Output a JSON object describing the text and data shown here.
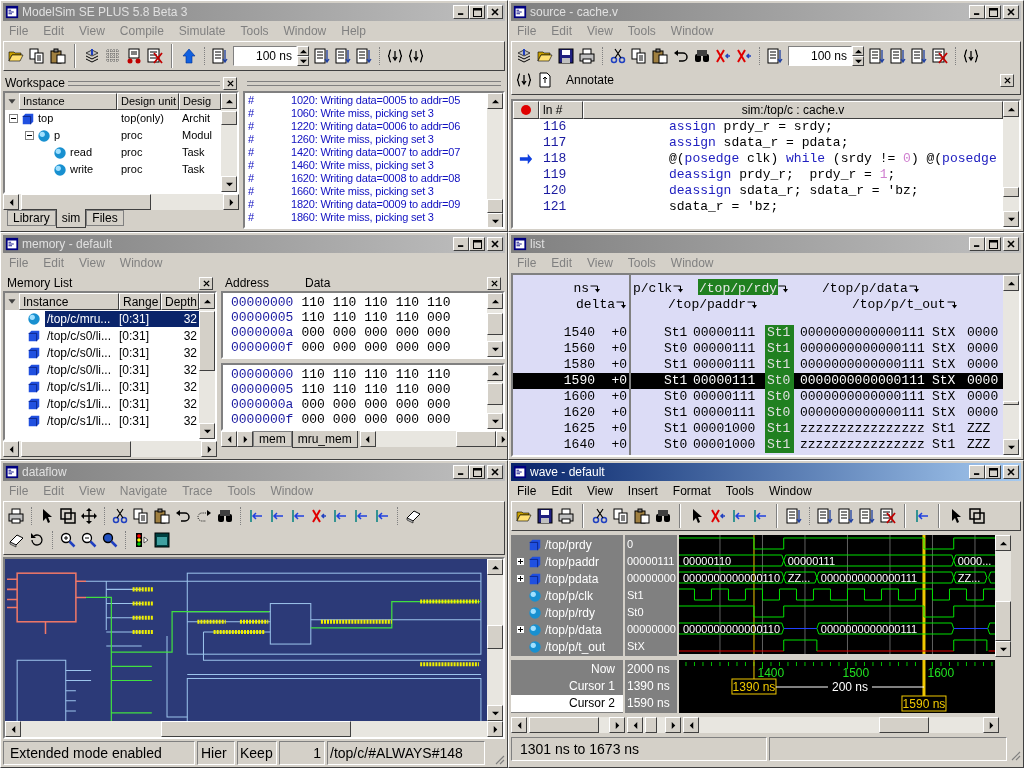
{
  "main_window": {
    "title": "ModelSim SE PLUS 5.8 Beta 3",
    "active": false,
    "menu": [
      "File",
      "Edit",
      "View",
      "Compile",
      "Simulate",
      "Tools",
      "Window",
      "Help"
    ],
    "time_step": "100 ns",
    "workspace": {
      "title": "Workspace",
      "columns": [
        "Instance",
        "Design unit",
        "Desig"
      ],
      "tree": [
        {
          "name": "top",
          "kind": "square",
          "unit": "top(only)",
          "type": "Archit",
          "expanded": true,
          "children": [
            {
              "name": "p",
              "kind": "sphere",
              "unit": "proc",
              "type": "Modul",
              "expanded": true,
              "children": [
                {
                  "name": "read",
                  "kind": "sphere",
                  "unit": "proc",
                  "type": "Task"
                },
                {
                  "name": "write",
                  "kind": "sphere",
                  "unit": "proc",
                  "type": "Task"
                }
              ]
            }
          ]
        }
      ],
      "tabs": [
        {
          "label": "Library",
          "selected": false
        },
        {
          "label": "sim",
          "selected": true
        },
        {
          "label": "Files",
          "selected": false
        }
      ]
    },
    "transcript": [
      {
        "prompt": "#",
        "text": "1020: Writing data=0005 to addr=05"
      },
      {
        "prompt": "#",
        "text": "1060: Write miss, picking set 3"
      },
      {
        "prompt": "#",
        "text": "1220: Writing data=0006 to addr=06"
      },
      {
        "prompt": "#",
        "text": "1260: Write miss, picking set 3"
      },
      {
        "prompt": "#",
        "text": "1420: Writing data=0007 to addr=07"
      },
      {
        "prompt": "#",
        "text": "1460: Write miss, picking set 3"
      },
      {
        "prompt": "#",
        "text": "1620: Writing data=0008 to addr=08"
      },
      {
        "prompt": "#",
        "text": "1660: Write miss, picking set 3"
      },
      {
        "prompt": "#",
        "text": "1820: Writing data=0009 to addr=09"
      },
      {
        "prompt": "#",
        "text": "1860: Write miss, picking set 3"
      }
    ]
  },
  "source_window": {
    "title": "source - cache.v",
    "active": false,
    "menu": [
      "File",
      "Edit",
      "View",
      "Tools",
      "Window"
    ],
    "time_step": "100 ns",
    "annotate": "Annotate",
    "line_header": "ln #",
    "file_header": "sim:/top/c : cache.v",
    "lines": [
      {
        "number": "116",
        "current": false,
        "code": [
          {
            "kind": "keyword",
            "text": "assign"
          },
          {
            "kind": "plain",
            "text": " prdy_r = srdy;"
          }
        ]
      },
      {
        "number": "117",
        "current": false,
        "code": [
          {
            "kind": "keyword",
            "text": "assign"
          },
          {
            "kind": "plain",
            "text": " sdata_r = pdata;"
          }
        ]
      },
      {
        "number": "118",
        "current": true,
        "code": [
          {
            "kind": "plain",
            "text": "@("
          },
          {
            "kind": "keyword",
            "text": "posedge"
          },
          {
            "kind": "plain",
            "text": " clk) "
          },
          {
            "kind": "keyword",
            "text": "while"
          },
          {
            "kind": "plain",
            "text": " (srdy != "
          },
          {
            "kind": "number",
            "text": "0"
          },
          {
            "kind": "plain",
            "text": ") @("
          },
          {
            "kind": "keyword",
            "text": "posedge"
          }
        ]
      },
      {
        "number": "119",
        "current": false,
        "code": [
          {
            "kind": "keyword",
            "text": "deassign"
          },
          {
            "kind": "plain",
            "text": " prdy_r;  prdy_r = "
          },
          {
            "kind": "number",
            "text": "1"
          },
          {
            "kind": "plain",
            "text": ";"
          }
        ]
      },
      {
        "number": "120",
        "current": false,
        "code": [
          {
            "kind": "keyword",
            "text": "deassign"
          },
          {
            "kind": "plain",
            "text": " sdata_r; sdata_r = 'bz;"
          }
        ]
      },
      {
        "number": "121",
        "current": false,
        "code": [
          {
            "kind": "plain",
            "text": "sdata_r = 'bz;"
          }
        ]
      }
    ]
  },
  "memory_window": {
    "title": "memory - default",
    "active": false,
    "menu": [
      "File",
      "Edit",
      "View",
      "Window"
    ],
    "list_title": "Memory List",
    "columns": [
      "Instance",
      "Range",
      "Depth"
    ],
    "instances": [
      {
        "kind": "sphere",
        "name": "/top/c/mru...",
        "range": "[0:31]",
        "depth": "32",
        "selected": true
      },
      {
        "kind": "square",
        "name": "/top/c/s0/li...",
        "range": "[0:31]",
        "depth": "32",
        "selected": false
      },
      {
        "kind": "square",
        "name": "/top/c/s0/li...",
        "range": "[0:31]",
        "depth": "32",
        "selected": false
      },
      {
        "kind": "square",
        "name": "/top/c/s0/li...",
        "range": "[0:31]",
        "depth": "32",
        "selected": false
      },
      {
        "kind": "square",
        "name": "/top/c/s1/li...",
        "range": "[0:31]",
        "depth": "32",
        "selected": false
      },
      {
        "kind": "square",
        "name": "/top/c/s1/li...",
        "range": "[0:31]",
        "depth": "32",
        "selected": false
      },
      {
        "kind": "square",
        "name": "/top/c/s1/li...",
        "range": "[0:31]",
        "depth": "32",
        "selected": false
      }
    ],
    "data_headers": [
      "Address",
      "Data"
    ],
    "panes": [
      {
        "rows": [
          {
            "address": "00000000",
            "values": [
              "110",
              "110",
              "110",
              "110",
              "110"
            ]
          },
          {
            "address": "00000005",
            "values": [
              "110",
              "110",
              "110",
              "110",
              "000"
            ]
          },
          {
            "address": "0000000a",
            "values": [
              "000",
              "000",
              "000",
              "000",
              "000"
            ]
          },
          {
            "address": "0000000f",
            "values": [
              "000",
              "000",
              "000",
              "000",
              "000"
            ]
          }
        ]
      },
      {
        "rows": [
          {
            "address": "00000000",
            "values": [
              "110",
              "110",
              "110",
              "110",
              "110"
            ]
          },
          {
            "address": "00000005",
            "values": [
              "110",
              "110",
              "110",
              "110",
              "000"
            ]
          },
          {
            "address": "0000000a",
            "values": [
              "000",
              "000",
              "000",
              "000",
              "000"
            ]
          },
          {
            "address": "0000000f",
            "values": [
              "000",
              "000",
              "000",
              "000",
              "000"
            ]
          }
        ]
      }
    ],
    "tabs": [
      {
        "label": "mem",
        "selected": false
      },
      {
        "label": "mru_mem",
        "selected": true
      }
    ]
  },
  "list_window": {
    "title": "list",
    "active": false,
    "menu": [
      "File",
      "Edit",
      "View",
      "Tools",
      "Window"
    ],
    "columns": [
      {
        "header": "ns",
        "selected": false
      },
      {
        "header": "delta",
        "selected": false
      },
      {
        "header": "p/clk",
        "selected": false
      },
      {
        "header": "/top/paddr",
        "selected": false
      },
      {
        "header": "/top/p/rdy",
        "selected": true
      },
      {
        "header": "/top/p/data",
        "selected": false
      },
      {
        "header": "/top/p/t_out",
        "selected": false
      }
    ],
    "rows": [
      {
        "selected": false,
        "cells": [
          "1540",
          "+0",
          "St1",
          "00000111",
          "St1",
          "0000000000000111",
          "StX",
          "0000"
        ]
      },
      {
        "selected": false,
        "cells": [
          "1560",
          "+0",
          "St0",
          "00000111",
          "St1",
          "0000000000000111",
          "StX",
          "0000"
        ]
      },
      {
        "selected": false,
        "cells": [
          "1580",
          "+0",
          "St1",
          "00000111",
          "St1",
          "0000000000000111",
          "StX",
          "0000"
        ]
      },
      {
        "selected": true,
        "cells": [
          "1590",
          "+0",
          "St1",
          "00000111",
          "St0",
          "0000000000000111",
          "StX",
          "0000"
        ]
      },
      {
        "selected": false,
        "cells": [
          "1600",
          "+0",
          "St0",
          "00000111",
          "St0",
          "0000000000000111",
          "StX",
          "0000"
        ]
      },
      {
        "selected": false,
        "cells": [
          "1620",
          "+0",
          "St1",
          "00000111",
          "St0",
          "0000000000000111",
          "StX",
          "0000"
        ]
      },
      {
        "selected": false,
        "cells": [
          "1625",
          "+0",
          "St1",
          "00001000",
          "St1",
          "zzzzzzzzzzzzzzzz",
          "St1",
          "ZZZ"
        ]
      },
      {
        "selected": false,
        "cells": [
          "1640",
          "+0",
          "St0",
          "00001000",
          "St1",
          "zzzzzzzzzzzzzzzz",
          "St1",
          "ZZZ"
        ]
      }
    ]
  },
  "dataflow_window": {
    "title": "dataflow",
    "active": false,
    "menu": [
      "File",
      "Edit",
      "View",
      "Navigate",
      "Trace",
      "Tools",
      "Window"
    ],
    "status": [
      "Extended mode enabled",
      "Hier",
      "Keep",
      "1",
      "/top/c/#ALWAYS#148"
    ]
  },
  "wave_window": {
    "title": "wave - default",
    "active": true,
    "menu": [
      "File",
      "Edit",
      "View",
      "Insert",
      "Format",
      "Tools",
      "Window"
    ],
    "signals": [
      {
        "kind": "square",
        "name": "/top/prdy",
        "value": "0"
      },
      {
        "kind": "square",
        "name": "/top/paddr",
        "value": "00000111",
        "expanded": false,
        "segments": [
          "00000110",
          "00000111",
          "0000..."
        ]
      },
      {
        "kind": "square",
        "name": "/top/pdata",
        "value": "00000000",
        "expanded": false,
        "segments": [
          "0000000000000110",
          "ZZ...",
          "0000000000000111",
          "ZZ..."
        ]
      },
      {
        "kind": "sphere",
        "name": "/top/p/clk",
        "value": "St1"
      },
      {
        "kind": "sphere",
        "name": "/top/p/rdy",
        "value": "St0"
      },
      {
        "kind": "sphere",
        "name": "/top/p/data",
        "value": "00000000",
        "expanded": false,
        "segments": [
          "0000000000000110",
          "0000000000000111"
        ]
      },
      {
        "kind": "sphere",
        "name": "/top/p/t_out",
        "value": "StX"
      }
    ],
    "cursors": [
      {
        "name": "Now",
        "value": "2000 ns",
        "selected": false
      },
      {
        "name": "Cursor 1",
        "value": "1390 ns",
        "label": "1390 ns",
        "selected": false
      },
      {
        "name": "Cursor 2",
        "value": "1590 ns",
        "label": "1590 ns",
        "selected": true
      }
    ],
    "ruler": [
      "1400",
      "1500",
      "1600"
    ],
    "cursor_delta": "200 ns",
    "status": "1301 ns to 1673 ns"
  }
}
